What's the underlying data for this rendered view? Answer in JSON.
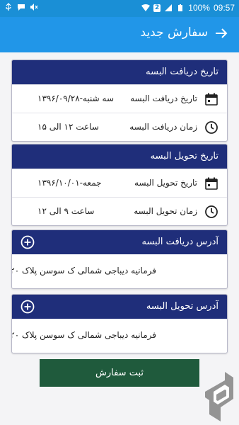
{
  "statusbar": {
    "battery": "100%",
    "time": "09:57",
    "sim_badge": "2",
    "icons": [
      "usb-icon",
      "message-icon",
      "mute-icon",
      "wifi-icon",
      "signal-icon",
      "battery-icon"
    ]
  },
  "appbar": {
    "title": "سفارش جدید",
    "back_icon": "arrow-forward-icon"
  },
  "pickup_date_card": {
    "header": "تاریخ دریافت البسه",
    "rows": [
      {
        "icon": "calendar-icon",
        "label": "تاریخ دریافت البسه",
        "value": "سه شنبه-۱۳۹۶/۰۹/۲۸"
      },
      {
        "icon": "clock-icon",
        "label": "زمان دریافت البسه",
        "value": "ساعت ۱۲ الی ۱۵"
      }
    ]
  },
  "delivery_date_card": {
    "header": "تاریخ تحویل البسه",
    "rows": [
      {
        "icon": "calendar-icon",
        "label": "تاریخ تحویل البسه",
        "value": "جمعه-۱۳۹۶/۱۰/۰۱"
      },
      {
        "icon": "clock-icon",
        "label": "زمان تحویل البسه",
        "value": "ساعت ۹ الی ۱۲"
      }
    ]
  },
  "pickup_address_card": {
    "header": "آدرس دریافت البسه",
    "address": "فرمانیه دیباجی شمالی ک سوسن پلاک ۲۰"
  },
  "delivery_address_card": {
    "header": "آدرس تحویل البسه",
    "address": "فرمانیه دیباجی شمالی ک سوسن پلاک ۲۰"
  },
  "submit_label": "ثبت سفارش",
  "colors": {
    "statusbar": "#1a8fd6",
    "appbar": "#2196e8",
    "card_header": "#1f2e7a",
    "submit": "#1f5a3c"
  }
}
